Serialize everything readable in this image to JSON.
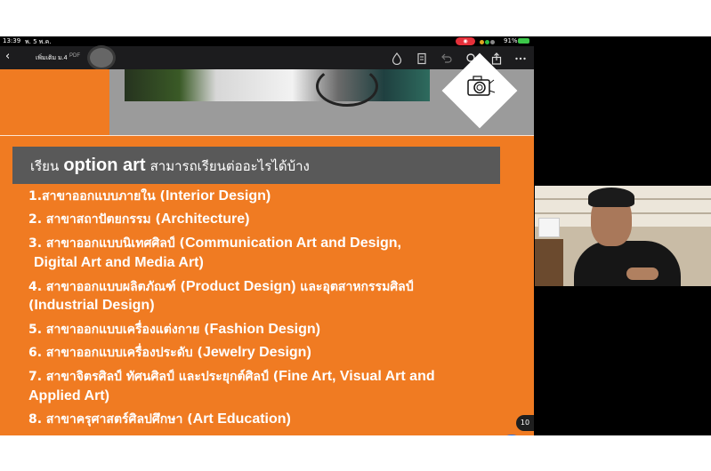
{
  "status_bar": {
    "time": "13:39",
    "date": "พ. 5 พ.ค.",
    "battery": "91%"
  },
  "toolbar": {
    "doc_title": "เพิ่มเติม ม.4",
    "doc_type": "PDF"
  },
  "slide": {
    "heading_th_prefix": "เรียน",
    "heading_en": "option art",
    "heading_th_suffix": "สามารถเรียนต่ออะไรได้บ้าง",
    "items": [
      {
        "th": "1.สาขาออกแบบภายใน (",
        "en": "Interior Design)"
      },
      {
        "th": "2. สาขาสถาปัตยกรรม (",
        "en": "Architecture)"
      },
      {
        "th": "3. สาขาออกแบบนิเทศศิลป์ (",
        "en": "Communication Art and Design,"
      },
      {
        "th": "",
        "en": "Digital Art and Media Art)"
      },
      {
        "th": "4. สาขาออกแบบผลิตภัณฑ์ (",
        "en": "Product Design)",
        "th2": " และอุตสาหกรรมศิลป์"
      },
      {
        "th": "(",
        "en": "Industrial Design)"
      },
      {
        "th": "5. สาขาออกแบบเครื่องแต่งกาย (",
        "en": "Fashion Design)"
      },
      {
        "th": "6. สาขาออกแบบเครื่องประดับ (",
        "en": "Jewelry Design)"
      },
      {
        "th": "7. สาขาจิตรศิลป์ ทัศนศิลป์ และประยุกต์ศิลป์ (",
        "en": "Fine Art, Visual Art and"
      },
      {
        "th": "",
        "en": "Applied Art)"
      },
      {
        "th": "8. สาขาครุศาสตร์ศิลปศึกษา (",
        "en": "Art Education)"
      }
    ]
  },
  "page_badge": "10",
  "colors": {
    "slide_orange": "#f07b22",
    "heading_gray": "#595959",
    "fab_blue": "#1d6ff2",
    "record_red": "#e5303a"
  },
  "icons": [
    "back-icon",
    "ink-drop-icon",
    "document-icon",
    "undo-icon",
    "search-icon",
    "share-icon",
    "more-icon",
    "pencil-icon",
    "camera-logo-icon"
  ]
}
